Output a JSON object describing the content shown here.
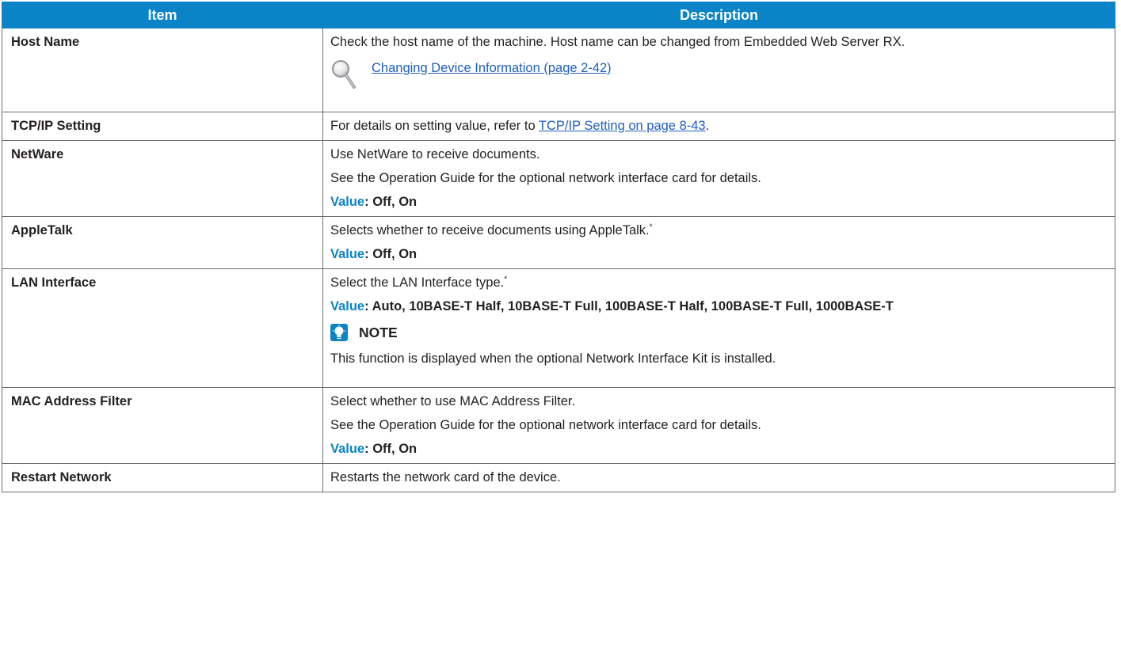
{
  "table": {
    "headers": {
      "item": "Item",
      "description": "Description"
    },
    "rows": {
      "host_name": {
        "item": "Host Name",
        "description": "Check the host name of the machine. Host name can be changed from Embedded Web Server RX.",
        "link": "Changing Device Information (page 2-42)"
      },
      "tcpip": {
        "item": "TCP/IP Setting",
        "desc_before": "For details on setting value, refer to ",
        "link": "TCP/IP Setting on page 8-43",
        "desc_after": "."
      },
      "netware": {
        "item": "NetWare",
        "line1": "Use NetWare to receive documents.",
        "line2": "See the Operation Guide for the optional network interface card for details.",
        "value_label": "Value",
        "value": ": Off, On"
      },
      "appletalk": {
        "item": "AppleTalk",
        "line1": "Selects whether to receive documents using AppleTalk.",
        "footnote_mark": "*",
        "value_label": "Value",
        "value": ": Off, On"
      },
      "lan_interface": {
        "item": "LAN Interface",
        "line1": "Select the LAN Interface type.",
        "footnote_mark": "*",
        "value_label": "Value",
        "value": ": Auto, 10BASE-T Half, 10BASE-T Full, 100BASE-T Half, 100BASE-T Full, 1000BASE-T",
        "note_title": "NOTE",
        "note_text": "This function is displayed when the optional Network Interface Kit is installed."
      },
      "mac_filter": {
        "item": "MAC Address Filter",
        "line1": "Select whether to use MAC Address Filter.",
        "line2": "See the Operation Guide for the optional network interface card for details.",
        "value_label": "Value",
        "value": ": Off, On"
      },
      "restart": {
        "item": "Restart Network",
        "line1": "Restarts the network card of the device."
      }
    }
  },
  "colors": {
    "header_bg": "#0a84c6",
    "value_label": "#0a84c6",
    "link": "#1f5fbf",
    "border": "#6d6e71"
  },
  "icons": {
    "reference": "magnifier-icon",
    "note": "note-bulb-icon"
  }
}
